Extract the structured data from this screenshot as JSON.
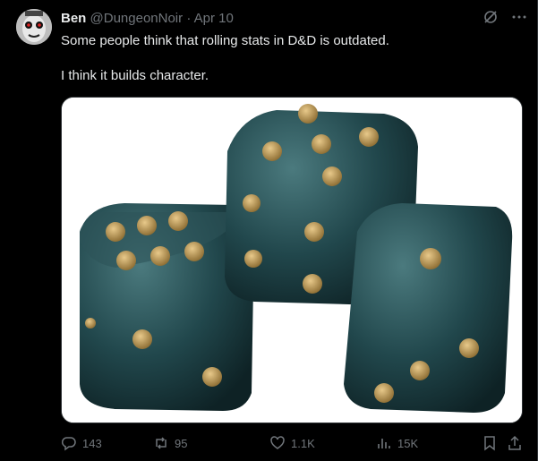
{
  "author": {
    "name": "Ben",
    "handle": "@DungeonNoir",
    "separator": "·",
    "date": "Apr 10"
  },
  "post": {
    "line1": "Some people think that rolling stats in D&D is outdated.",
    "line2": "I think it builds character."
  },
  "media": {
    "description_icon": "dice-photo",
    "dice_color": "#1f3f44",
    "pip_color": "#c9a25a"
  },
  "metrics": {
    "replies": "143",
    "reposts": "95",
    "likes": "1.1K",
    "views": "15K"
  },
  "icons": {
    "grok": "grok-icon",
    "more": "more-icon",
    "reply": "reply-icon",
    "repost": "repost-icon",
    "like": "heart-icon",
    "views": "views-icon",
    "bookmark": "bookmark-icon",
    "share": "share-icon"
  },
  "colors": {
    "background": "#000000",
    "text": "#e7e9ea",
    "muted": "#71767b",
    "border": "#2f3336"
  }
}
